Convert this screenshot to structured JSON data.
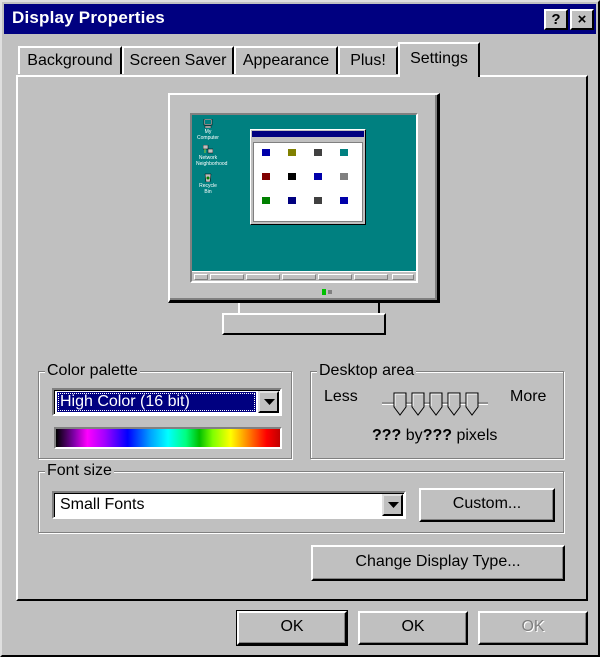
{
  "window": {
    "title": "Display Properties",
    "help_button": "?",
    "close_button": "×"
  },
  "tabs": [
    {
      "label": "Background",
      "active": false
    },
    {
      "label": "Screen Saver",
      "active": false
    },
    {
      "label": "Appearance",
      "active": false
    },
    {
      "label": "Plus!",
      "active": false
    },
    {
      "label": "Settings",
      "active": true
    }
  ],
  "preview": {
    "desktop_color": "#008080",
    "desktop_icons": [
      "My Computer",
      "Network Neighborhood",
      "Recycle Bin"
    ]
  },
  "color_palette": {
    "label": "Color palette",
    "selected_value": "High Color (16 bit)"
  },
  "desktop_area": {
    "label": "Desktop area",
    "less_label": "Less",
    "more_label": "More",
    "resolution_width": "???",
    "by_text": "by",
    "resolution_height": "???",
    "pixels_text": "pixels"
  },
  "font_size": {
    "label": "Font size",
    "selected_value": "Small Fonts",
    "custom_button": "Custom..."
  },
  "change_display_type_button": "Change Display Type...",
  "footer": {
    "ok_button_1": "OK",
    "ok_button_2": "OK",
    "ok_button_3": "OK"
  },
  "colors": {
    "title_bar": "#000080",
    "face": "#c0c0c0",
    "selection": "#000080"
  }
}
